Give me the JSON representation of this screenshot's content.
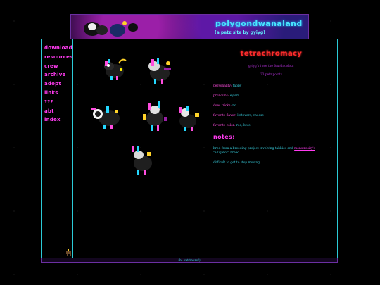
{
  "site": {
    "title": "polygondwanaland",
    "subtitle": "(a petz site by gyiyg)"
  },
  "nav": {
    "items": [
      "download",
      "resources",
      "crew",
      "archive",
      "adopt",
      "links",
      "???",
      "abt",
      "index"
    ]
  },
  "profile": {
    "name": "tetrachromacy",
    "caption": "gyiyg's i see the fourth colour",
    "points": "23 petz points",
    "fields": [
      {
        "label": "personality:",
        "value": "tabby"
      },
      {
        "label": "pronouns:",
        "value": "ey/em"
      },
      {
        "label": "does tricks:",
        "value": "no"
      },
      {
        "label": "favorite flavor:",
        "value": "leftovers, cheese"
      },
      {
        "label": "favorite color:",
        "value": "red, blue"
      }
    ],
    "notes_heading": "notes:",
    "notes": [
      {
        "before": "bred from a breeding project involving tabbies and ",
        "link": "monstrosity's",
        "after": " \"alligator\" breed."
      },
      {
        "before": "difficult to get to stop moving.",
        "link": "",
        "after": ""
      }
    ]
  },
  "footer": {
    "text": "(hi out there!)"
  },
  "colors": {
    "cyan": "#2bcad6",
    "magenta": "#ff3bf0",
    "red": "#ff2c2c",
    "purple": "#b330d9"
  }
}
